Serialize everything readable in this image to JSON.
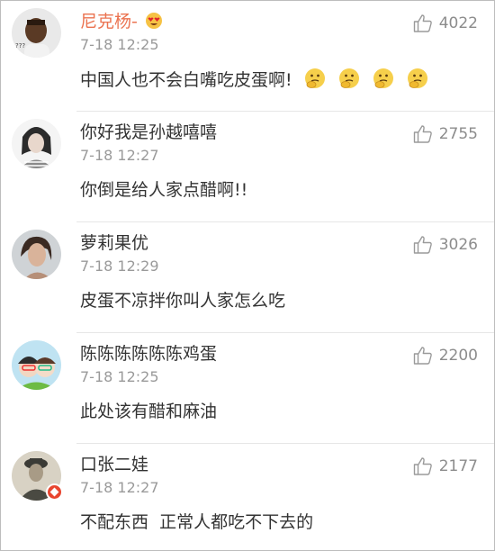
{
  "comments": [
    {
      "name": "尼克杨-",
      "name_emoji": "heart-eyes-emoji",
      "time": "7-18 12:25",
      "text": "中国人也不会白嘴吃皮蛋啊!",
      "text_emojis": [
        "thinking-emoji",
        "thinking-emoji",
        "thinking-emoji",
        "thinking-emoji"
      ],
      "likes": "4022",
      "name_color": "#eb7350"
    },
    {
      "name": "你好我是孙越嘻嘻",
      "time": "7-18 12:27",
      "text": "你倒是给人家点醋啊!!",
      "likes": "2755"
    },
    {
      "name": "萝莉果优",
      "time": "7-18 12:29",
      "text": "皮蛋不凉拌你叫人家怎么吃",
      "likes": "3026"
    },
    {
      "name": "陈陈陈陈陈陈鸡蛋",
      "time": "7-18 12:25",
      "text": "此处该有醋和麻油",
      "likes": "2200"
    },
    {
      "name": "口张二娃",
      "time": "7-18 12:27",
      "text": "不配东西  正常人都吃不下去的",
      "likes": "2177",
      "verified_badge": "verified-badge-icon"
    }
  ],
  "icons": {
    "like": "thumbs-up-icon"
  },
  "colors": {
    "vip_name": "#eb7350",
    "badge": "#e8452f",
    "meta": "#9a9a9a"
  }
}
